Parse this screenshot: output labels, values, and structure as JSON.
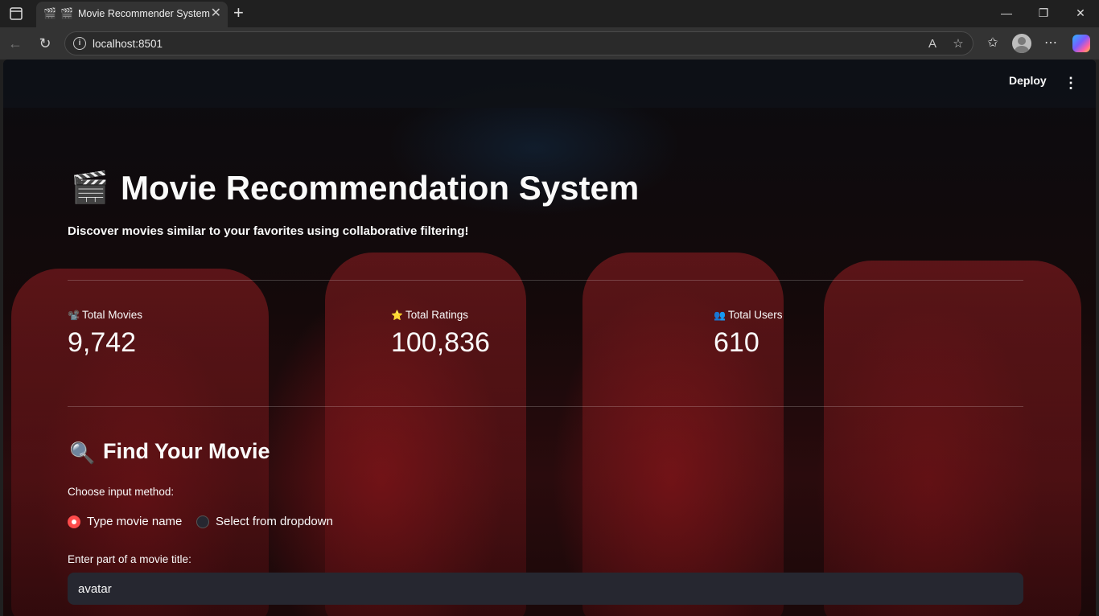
{
  "browser": {
    "tab_title": "Movie Recommender System",
    "tab_icon": "🎬",
    "url": "localhost:8501"
  },
  "header": {
    "deploy_label": "Deploy"
  },
  "app": {
    "title_icon": "🎬",
    "title": "Movie Recommendation System",
    "subtitle": "Discover movies similar to your favorites using collaborative filtering!",
    "metrics": [
      {
        "icon": "📽️",
        "label": "Total Movies",
        "value": "9,742"
      },
      {
        "icon": "⭐",
        "label": "Total Ratings",
        "value": "100,836"
      },
      {
        "icon": "👥",
        "label": "Total Users",
        "value": "610"
      }
    ],
    "section_icon": "🔍",
    "section_title": "Find Your Movie",
    "input_method_label": "Choose input method:",
    "radio_options": [
      {
        "label": "Type movie name",
        "selected": true
      },
      {
        "label": "Select from dropdown",
        "selected": false
      }
    ],
    "search_label": "Enter part of a movie title:",
    "search_value": "avatar"
  },
  "colors": {
    "accent": "#ff4b4b",
    "app_background": "#0e1117",
    "input_background": "#262730",
    "text": "#fafafa"
  }
}
